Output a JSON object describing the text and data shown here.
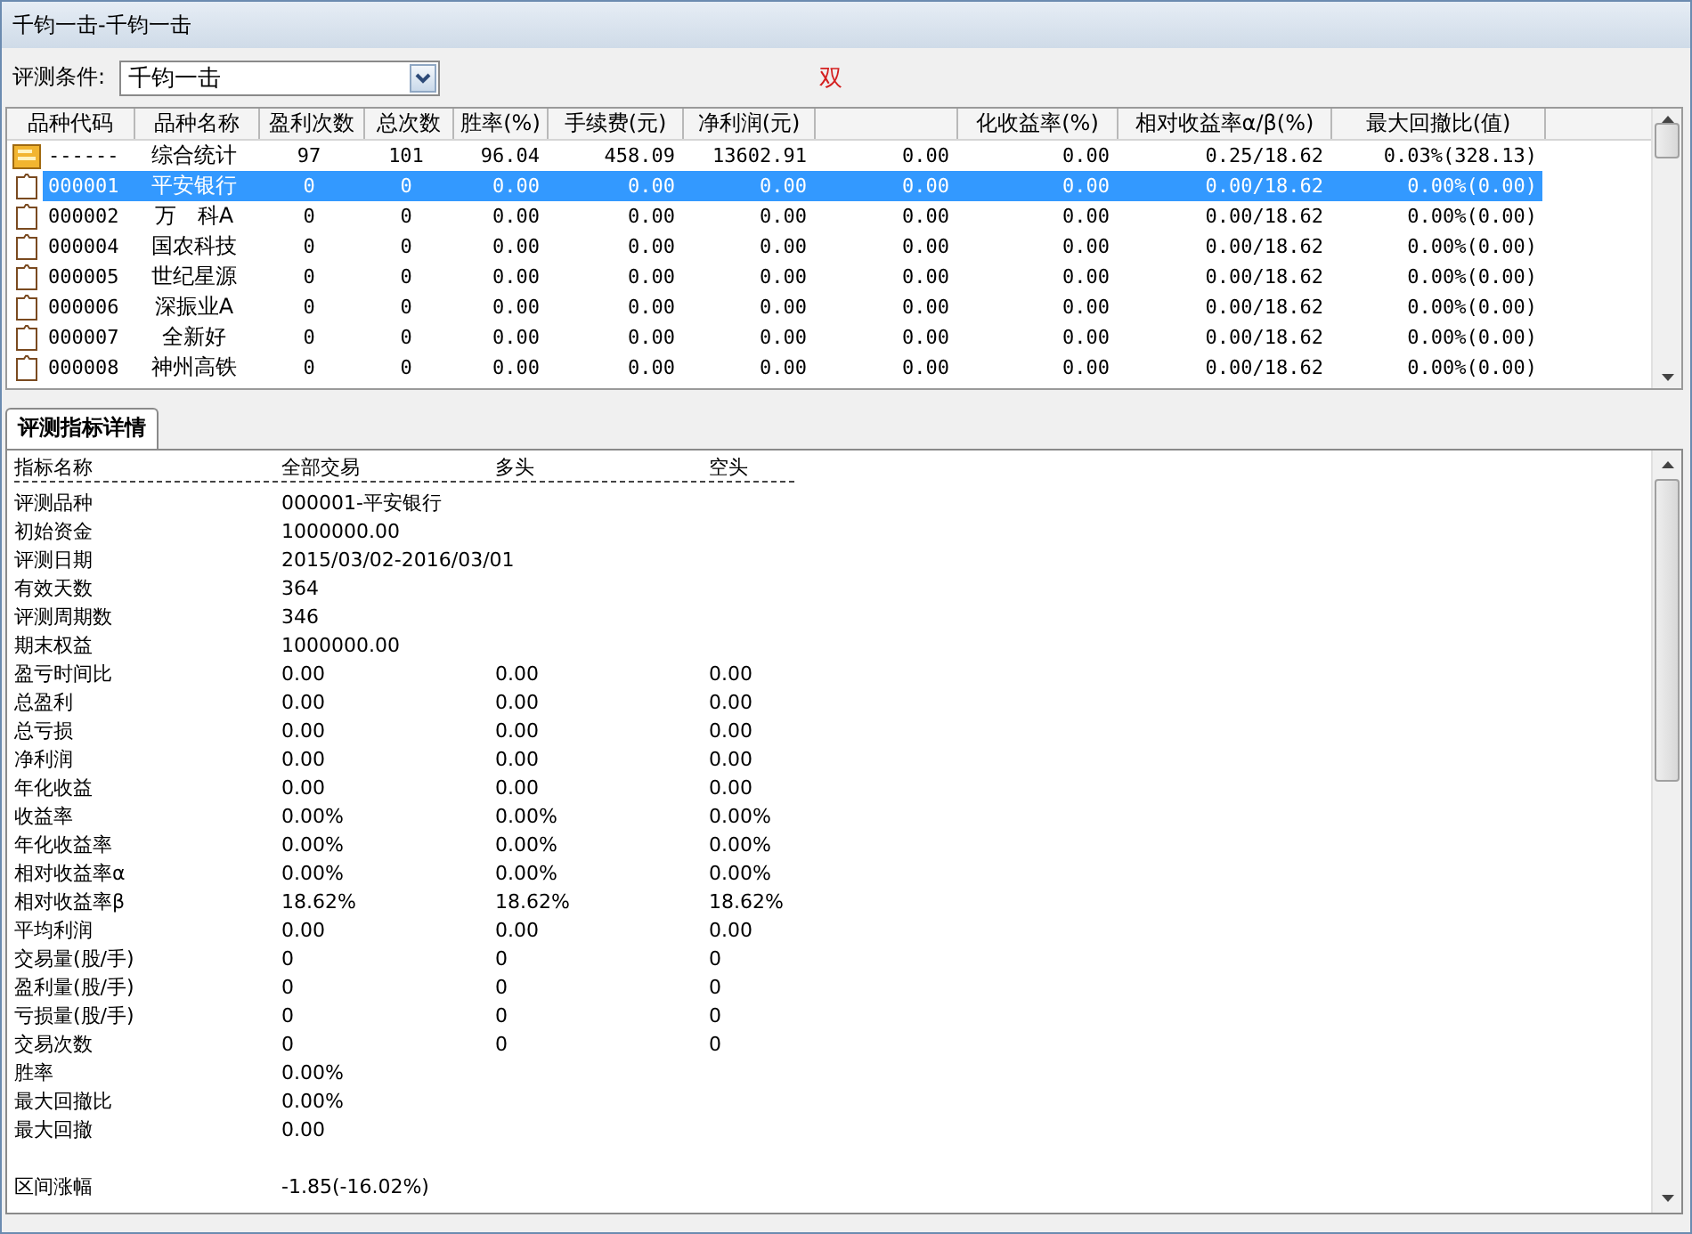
{
  "window": {
    "title": "千钧一击-千钧一击"
  },
  "toolbar": {
    "label": "评测条件:",
    "select": {
      "value": "千钧一击"
    },
    "note": "双"
  },
  "table": {
    "columns": [
      {
        "kind": "text",
        "label": "品种代码"
      },
      {
        "kind": "text",
        "label": "品种名称"
      },
      {
        "kind": "text",
        "label": "盈利次数"
      },
      {
        "kind": "text",
        "label": "总次数"
      },
      {
        "kind": "text",
        "label": "胜率(%)"
      },
      {
        "kind": "text",
        "label": "手续费(元)"
      },
      {
        "kind": "text",
        "label": "净利润(元)"
      },
      {
        "kind": "blank"
      },
      {
        "kind": "text",
        "label": "化收益率(%)"
      },
      {
        "kind": "text",
        "label": "相对收益率α/β(%)"
      },
      {
        "kind": "text",
        "label": "最大回撤比(值)"
      }
    ],
    "rows": [
      {
        "kind": "summary",
        "selected": false,
        "cells": [
          "------",
          "综合统计",
          "97",
          "101",
          "96.04",
          "458.09",
          "13602.91",
          "0.00",
          "0.00",
          "0.25/18.62",
          "0.03%(328.13)"
        ]
      },
      {
        "kind": "stock",
        "selected": true,
        "cells": [
          "000001",
          "平安银行",
          "0",
          "0",
          "0.00",
          "0.00",
          "0.00",
          "0.00",
          "0.00",
          "0.00/18.62",
          "0.00%(0.00)"
        ]
      },
      {
        "kind": "stock",
        "selected": false,
        "cells": [
          "000002",
          "万　科A",
          "0",
          "0",
          "0.00",
          "0.00",
          "0.00",
          "0.00",
          "0.00",
          "0.00/18.62",
          "0.00%(0.00)"
        ]
      },
      {
        "kind": "stock",
        "selected": false,
        "cells": [
          "000004",
          "国农科技",
          "0",
          "0",
          "0.00",
          "0.00",
          "0.00",
          "0.00",
          "0.00",
          "0.00/18.62",
          "0.00%(0.00)"
        ]
      },
      {
        "kind": "stock",
        "selected": false,
        "cells": [
          "000005",
          "世纪星源",
          "0",
          "0",
          "0.00",
          "0.00",
          "0.00",
          "0.00",
          "0.00",
          "0.00/18.62",
          "0.00%(0.00)"
        ]
      },
      {
        "kind": "stock",
        "selected": false,
        "cells": [
          "000006",
          "深振业A",
          "0",
          "0",
          "0.00",
          "0.00",
          "0.00",
          "0.00",
          "0.00",
          "0.00/18.62",
          "0.00%(0.00)"
        ]
      },
      {
        "kind": "stock",
        "selected": false,
        "cells": [
          "000007",
          "全新好",
          "0",
          "0",
          "0.00",
          "0.00",
          "0.00",
          "0.00",
          "0.00",
          "0.00/18.62",
          "0.00%(0.00)"
        ]
      },
      {
        "kind": "stock",
        "selected": false,
        "cells": [
          "000008",
          "神州高铁",
          "0",
          "0",
          "0.00",
          "0.00",
          "0.00",
          "0.00",
          "0.00",
          "0.00/18.62",
          "0.00%(0.00)"
        ]
      }
    ]
  },
  "tabs": [
    {
      "label": "评测指标详情",
      "selected": true
    }
  ],
  "details": {
    "columns": [
      "指标名称",
      "全部交易",
      "多头",
      "空头"
    ],
    "rows": [
      {
        "kind": "data",
        "label": "评测品种",
        "values": [
          "000001-平安银行"
        ]
      },
      {
        "kind": "data",
        "label": "初始资金",
        "values": [
          "1000000.00"
        ]
      },
      {
        "kind": "data",
        "label": "评测日期",
        "values": [
          "2015/03/02-2016/03/01"
        ]
      },
      {
        "kind": "data",
        "label": "有效天数",
        "values": [
          "364"
        ]
      },
      {
        "kind": "data",
        "label": "评测周期数",
        "values": [
          "346"
        ]
      },
      {
        "kind": "data",
        "label": "期末权益",
        "values": [
          "1000000.00"
        ]
      },
      {
        "kind": "data",
        "label": "盈亏时间比",
        "values": [
          "0.00",
          "0.00",
          "0.00"
        ]
      },
      {
        "kind": "data",
        "label": "总盈利",
        "values": [
          "0.00",
          "0.00",
          "0.00"
        ]
      },
      {
        "kind": "data",
        "label": "总亏损",
        "values": [
          "0.00",
          "0.00",
          "0.00"
        ]
      },
      {
        "kind": "data",
        "label": "净利润",
        "values": [
          "0.00",
          "0.00",
          "0.00"
        ]
      },
      {
        "kind": "data",
        "label": "年化收益",
        "values": [
          "0.00",
          "0.00",
          "0.00"
        ]
      },
      {
        "kind": "data",
        "label": "收益率",
        "values": [
          "0.00%",
          "0.00%",
          "0.00%"
        ]
      },
      {
        "kind": "data",
        "label": "年化收益率",
        "values": [
          "0.00%",
          "0.00%",
          "0.00%"
        ]
      },
      {
        "kind": "data",
        "label": "相对收益率α",
        "values": [
          "0.00%",
          "0.00%",
          "0.00%"
        ]
      },
      {
        "kind": "data",
        "label": "相对收益率β",
        "values": [
          "18.62%",
          "18.62%",
          "18.62%"
        ]
      },
      {
        "kind": "data",
        "label": "平均利润",
        "values": [
          "0.00",
          "0.00",
          "0.00"
        ]
      },
      {
        "kind": "data",
        "label": "交易量(股/手)",
        "values": [
          "0",
          "0",
          "0"
        ]
      },
      {
        "kind": "data",
        "label": "盈利量(股/手)",
        "values": [
          "0",
          "0",
          "0"
        ]
      },
      {
        "kind": "data",
        "label": "亏损量(股/手)",
        "values": [
          "0",
          "0",
          "0"
        ]
      },
      {
        "kind": "data",
        "label": "交易次数",
        "values": [
          "0",
          "0",
          "0"
        ]
      },
      {
        "kind": "data",
        "label": "胜率",
        "values": [
          "0.00%"
        ]
      },
      {
        "kind": "data",
        "label": "最大回撤比",
        "values": [
          "0.00%"
        ]
      },
      {
        "kind": "data",
        "label": "最大回撤",
        "values": [
          "0.00"
        ]
      },
      {
        "kind": "gap"
      },
      {
        "kind": "data",
        "label": "区间涨幅",
        "values": [
          "-1.85(-16.02%)"
        ]
      }
    ]
  }
}
